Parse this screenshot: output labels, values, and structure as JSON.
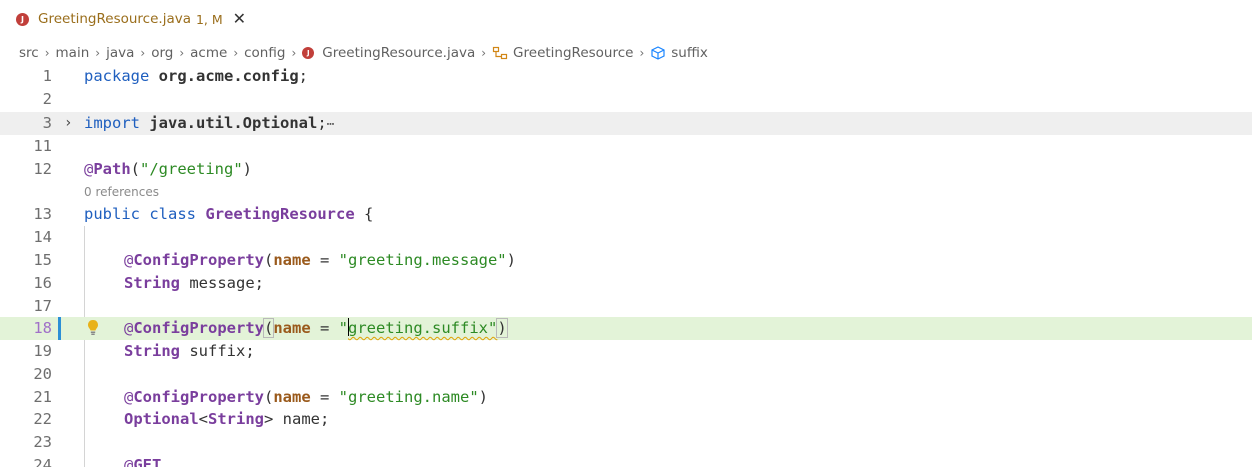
{
  "tab": {
    "icon_letter": "J",
    "title": "GreetingResource.java",
    "badge": "1, M",
    "close_glyph": "✕"
  },
  "breadcrumb": {
    "items": [
      "src",
      "main",
      "java",
      "org",
      "acme",
      "config"
    ],
    "file": "GreetingResource.java",
    "class": "GreetingResource",
    "field": "suffix",
    "separator": "›"
  },
  "editor": {
    "codelens": "0 references",
    "fold_ellipsis": "⋯",
    "line_numbers": [
      "1",
      "2",
      "3",
      "11",
      "12",
      "13",
      "14",
      "15",
      "16",
      "17",
      "18",
      "19",
      "20",
      "21",
      "22",
      "23",
      "24"
    ],
    "code": {
      "l1_kw": "package",
      "l1_pkg": "org.acme.config",
      "l1_end": ";",
      "l3_kw": "import",
      "l3_pkg": "java.util.Optional",
      "l3_end": ";",
      "l12_at": "@",
      "l12_ann": "Path",
      "l12_open": "(",
      "l12_str": "\"/greeting\"",
      "l12_close": ")",
      "l13_kw1": "public",
      "l13_kw2": "class",
      "l13_cls": "GreetingResource",
      "l13_end": "{",
      "l15_at": "@",
      "l15_ann": "ConfigProperty",
      "l15_open": "(",
      "l15_param": "name",
      "l15_eq": " = ",
      "l15_str": "\"greeting.message\"",
      "l15_close": ")",
      "l16_type": "String",
      "l16_rest": " message;",
      "l18_at": "@",
      "l18_ann": "ConfigProperty",
      "l18_open": "(",
      "l18_param": "name",
      "l18_eq": " = ",
      "l18_str_q": "\"",
      "l18_str_body": "greeting.suffix\"",
      "l18_close": ")",
      "l19_type": "String",
      "l19_rest": " suffix;",
      "l21_at": "@",
      "l21_ann": "ConfigProperty",
      "l21_open": "(",
      "l21_param": "name",
      "l21_eq": " = ",
      "l21_str": "\"greeting.name\"",
      "l21_close": ")",
      "l22_type1": "Optional",
      "l22_lt": "<",
      "l22_type2": "String",
      "l22_gt": ">",
      "l22_rest": " name;",
      "l24_at": "@",
      "l24_ann": "GET"
    }
  },
  "colors": {
    "keyword": "#1f5fbf",
    "annotation": "#7a3e9d",
    "string": "#2d8a24",
    "tab_modified": "#9a6e1c",
    "current_line": "#e3f3d8",
    "modified_gutter": "#2b8fd6"
  }
}
